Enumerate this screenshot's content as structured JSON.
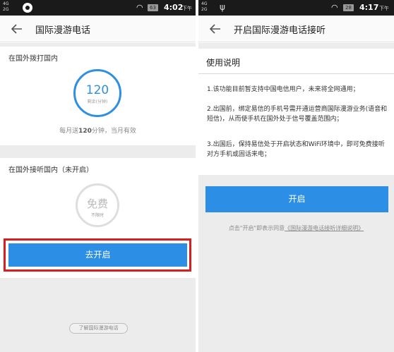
{
  "left": {
    "status": {
      "signal_top": "4G",
      "signal_bottom": "2G",
      "battery": "63",
      "time": "4:02",
      "ampm": "下午"
    },
    "title": "国际漫游电话",
    "dial_section": {
      "label": "在国外拨打国内",
      "minutes": "120",
      "minutes_label": "剩余(分钟)",
      "monthly_prefix": "每月送",
      "monthly_value": "120",
      "monthly_suffix": "分钟，当月有效"
    },
    "receive_section": {
      "label": "在国外接听国内（未开启）",
      "free_text": "免费",
      "unlimited_text": "不限时"
    },
    "enable_button": "去开启",
    "learn_more": "了解国际漫游电话"
  },
  "right": {
    "status": {
      "signal_top": "4G",
      "signal_bottom": "2G",
      "battery": "28",
      "time": "4:17",
      "ampm": "下午"
    },
    "title": "开启国际漫游电话接听",
    "usage_title": "使用说明",
    "items": [
      "1.该功能目前暂支持中国电信用户，未来将全网通用；",
      "2.出国前，绑定易信的手机号需开通运营商国际漫游业务(语音和短信)，从而使手机在国外处于信号覆盖范围内；",
      "3.出国后，保持易信处于开启状态和WiFi环境中，即可免费接听对方手机或固话来电；"
    ],
    "enable_button": "开启",
    "hint_prefix": "点击\"开启\"即表示同意",
    "hint_link": "《国际漫游电话接听详细说明》"
  },
  "colors": {
    "accent_blue": "#2d8ee6",
    "highlight_red": "#d81f1f",
    "statusbar": "#1a1a1a"
  }
}
